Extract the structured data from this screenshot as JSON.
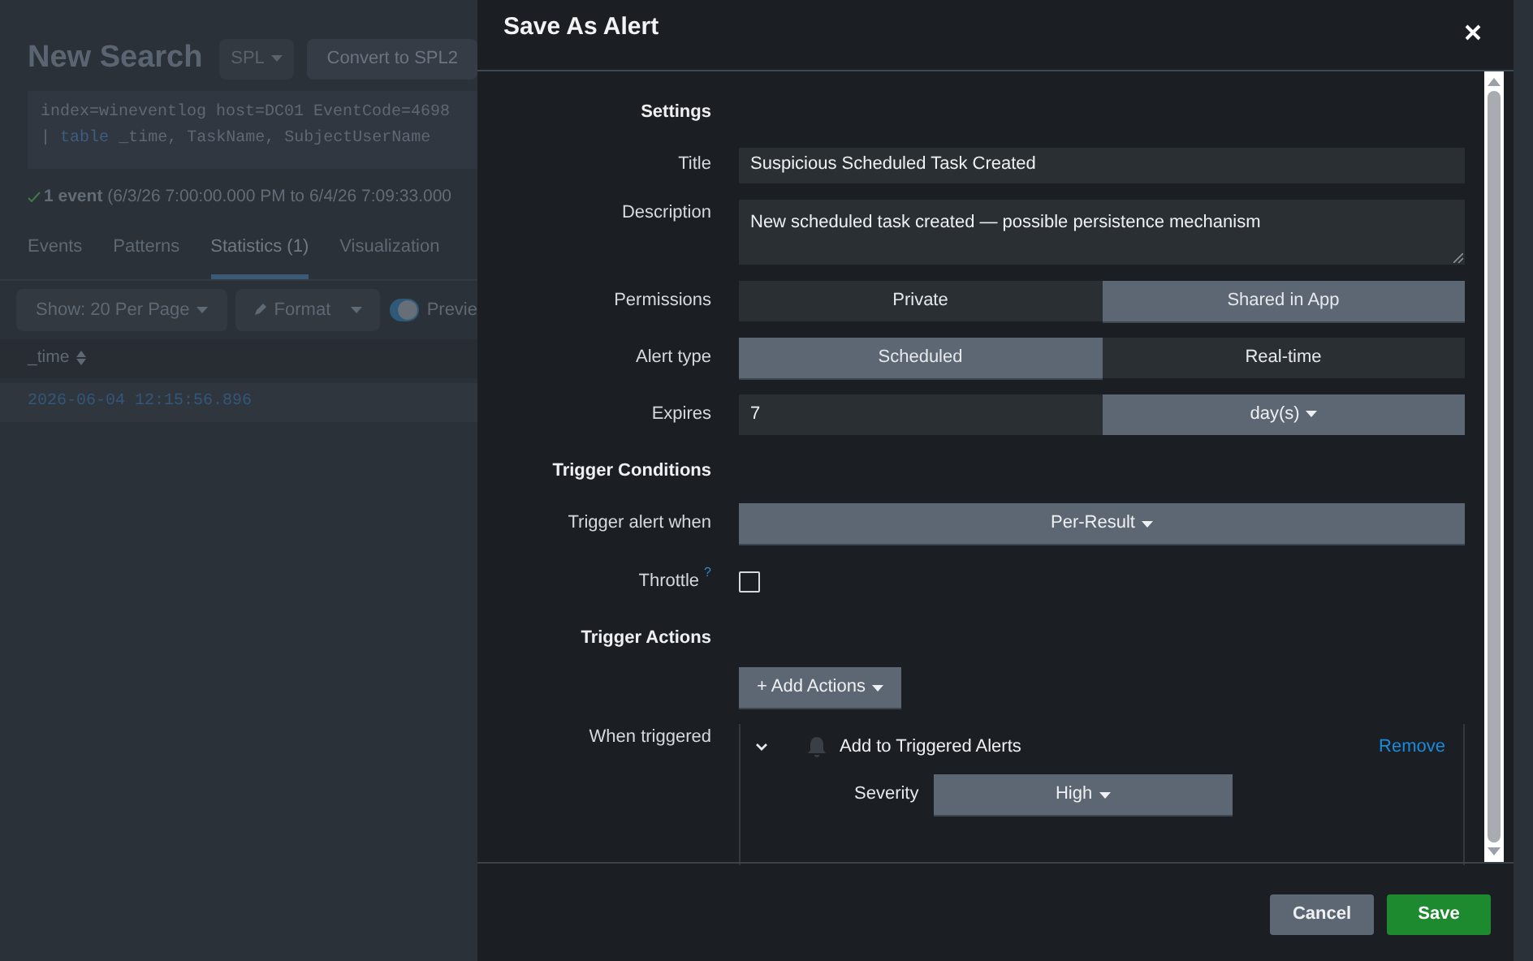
{
  "background": {
    "title": "New Search",
    "language_button": "SPL",
    "convert_button": "Convert to SPL2",
    "query": {
      "line_1": "index=wineventlog host=DC01 EventCode=4698",
      "pipe": "|",
      "command": "table",
      "args": "_time, TaskName, SubjectUserName"
    },
    "status": {
      "count": "1 event",
      "range": "(6/3/26 7:00:00.000 PM to 6/4/26 7:09:33.000"
    },
    "tabs": [
      {
        "label": "Events",
        "selected": false
      },
      {
        "label": "Patterns",
        "selected": false
      },
      {
        "label": "Statistics (1)",
        "selected": true
      },
      {
        "label": "Visualization",
        "selected": false
      }
    ],
    "toolbar": {
      "page_size": "Show: 20 Per Page",
      "format": "Format",
      "preview": {
        "label": "Previe",
        "on": true
      }
    },
    "table": {
      "columns": [
        "_time"
      ],
      "rows": [
        [
          "2026-06-04 12:15:56.896"
        ]
      ]
    }
  },
  "dialog": {
    "title": "Save As Alert",
    "settings": {
      "heading": "Settings",
      "title": {
        "label": "Title",
        "value": "Suspicious Scheduled Task Created"
      },
      "description": {
        "label": "Description",
        "value": "New scheduled task created — possible persistence mechanism"
      },
      "permissions": {
        "label": "Permissions",
        "options": [
          {
            "label": "Private",
            "selected": false
          },
          {
            "label": "Shared in App",
            "selected": true
          }
        ]
      },
      "alert_type": {
        "label": "Alert type",
        "options": [
          {
            "label": "Scheduled",
            "selected": true
          },
          {
            "label": "Real-time",
            "selected": false
          }
        ]
      },
      "expires": {
        "label": "Expires",
        "value": "7",
        "unit": "day(s)"
      }
    },
    "trigger_conditions": {
      "heading": "Trigger Conditions",
      "trigger_when": {
        "label": "Trigger alert when",
        "value": "Per-Result"
      },
      "throttle": {
        "label": "Throttle",
        "help": "?",
        "checked": false
      }
    },
    "trigger_actions": {
      "heading": "Trigger Actions",
      "add_button": "+ Add Actions",
      "when_triggered": {
        "label": "When triggered",
        "actions": [
          {
            "name": "Add to Triggered Alerts",
            "expanded": true,
            "remove": "Remove",
            "severity": {
              "label": "Severity",
              "value": "High"
            }
          }
        ]
      }
    },
    "buttons": {
      "cancel": "Cancel",
      "save": "Save"
    }
  }
}
